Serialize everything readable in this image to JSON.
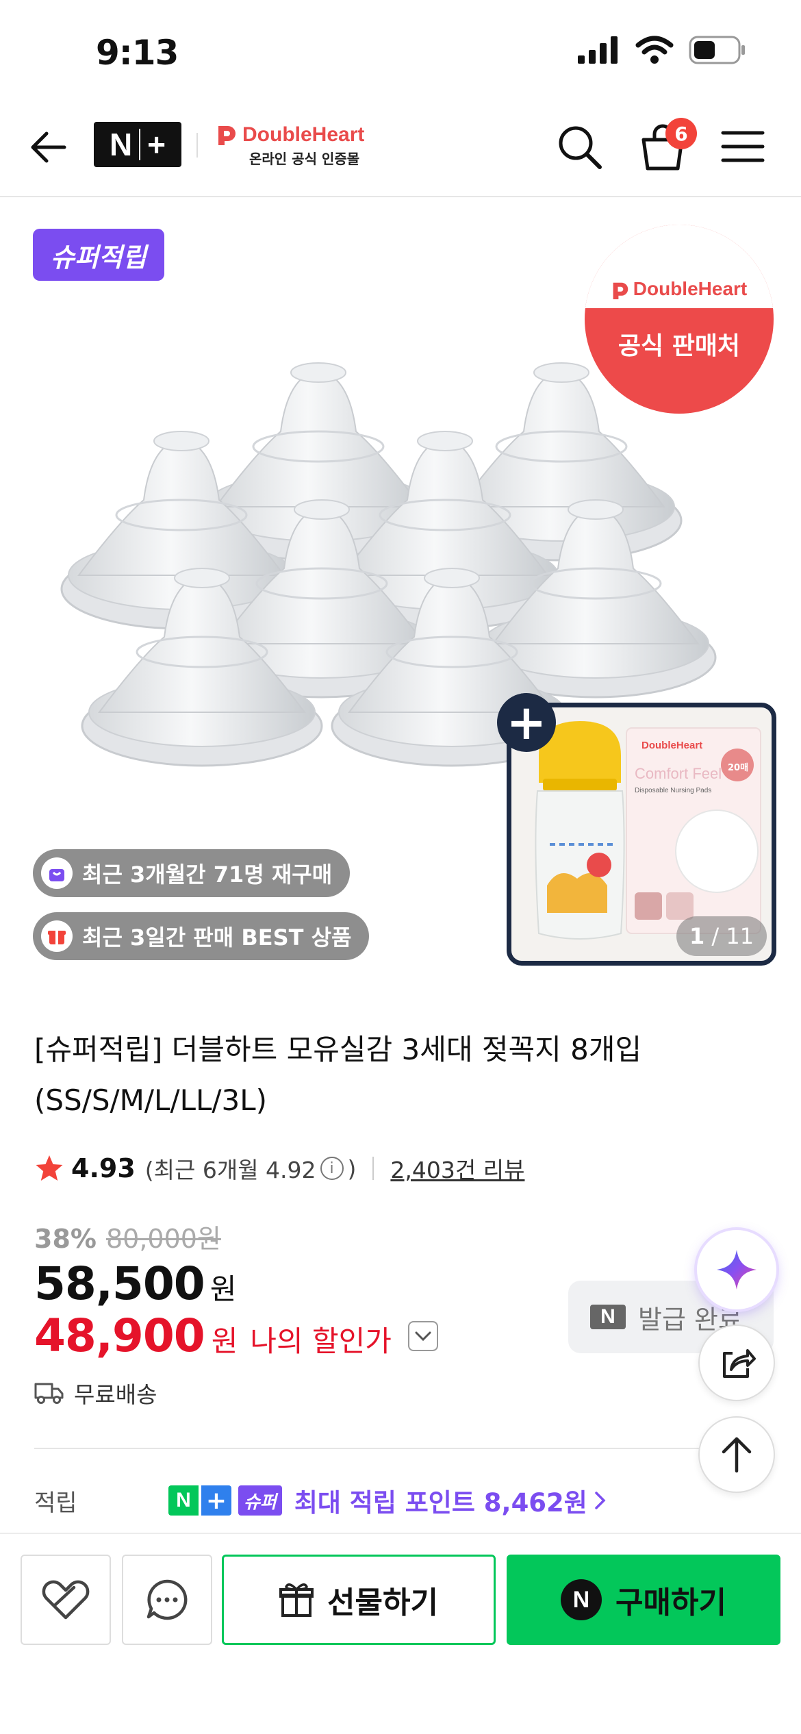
{
  "status_bar": {
    "time": "9:13"
  },
  "header": {
    "logo_text": "N+",
    "brand_name": "DoubleHeart",
    "brand_sub": "온라인 공식 인증몰",
    "cart_count": "6"
  },
  "hero": {
    "super_badge": "슈퍼적립",
    "seal_brand": "DoubleHeart",
    "seal_label": "공식 판매처",
    "tags": [
      {
        "label": "최근 3개월간 71명 재구매",
        "icon": "shopping-bag-icon",
        "icon_color": "#7b4df0"
      },
      {
        "label": "최근 3일간 판매 BEST 상품",
        "icon": "gift-icon",
        "icon_color": "#f2433a"
      }
    ],
    "addon": {
      "brand": "DoubleHeart",
      "pads_title": "Comfort Feel",
      "pads_sub": "Disposable Nursing Pads",
      "pads_count": "20매"
    },
    "image_index": "1",
    "image_total": "/ 11"
  },
  "product": {
    "title": "[슈퍼적립] 더블하트 모유실감 3세대 젖꼭지 8개입 (SS/S/M/L/LL/3L)",
    "rating": "4.93",
    "recent_rating": "(최근 6개월 4.92",
    "recent_rating_close": ")",
    "review_count": "2,403건 리뷰",
    "discount_rate": "38%",
    "original_price": "80,000원",
    "price": "58,500",
    "price_unit": "원",
    "my_price": "48,900",
    "my_price_unit": "원",
    "my_price_label": "나의 할인가",
    "shipping": "무료배송",
    "coupon_status": "발급 완료",
    "points_label": "적립",
    "points_badge_super": "슈퍼",
    "points_text": "최대 적립 포인트 8,462원"
  },
  "bottom_bar": {
    "gift_label": "선물하기",
    "buy_label": "구매하기"
  },
  "colors": {
    "accent_purple": "#7b4df0",
    "naver_green": "#03c75a",
    "sale_red": "#e5132a",
    "brand_red": "#e94b4b"
  }
}
